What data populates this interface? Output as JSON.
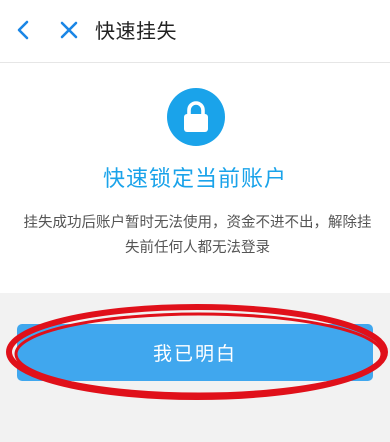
{
  "header": {
    "title": "快速挂失",
    "back_icon": "chevron-left-icon",
    "close_icon": "close-icon"
  },
  "main": {
    "lock_icon": "lock-icon",
    "heading": "快速锁定当前账户",
    "description": "挂失成功后账户暂时无法使用，资金不进不出，解除挂失前任何人都无法登录"
  },
  "actions": {
    "confirm_label": "我已明白"
  },
  "colors": {
    "accent": "#1aa3ea",
    "button": "#40a7ee",
    "annotation": "#e0101a"
  }
}
